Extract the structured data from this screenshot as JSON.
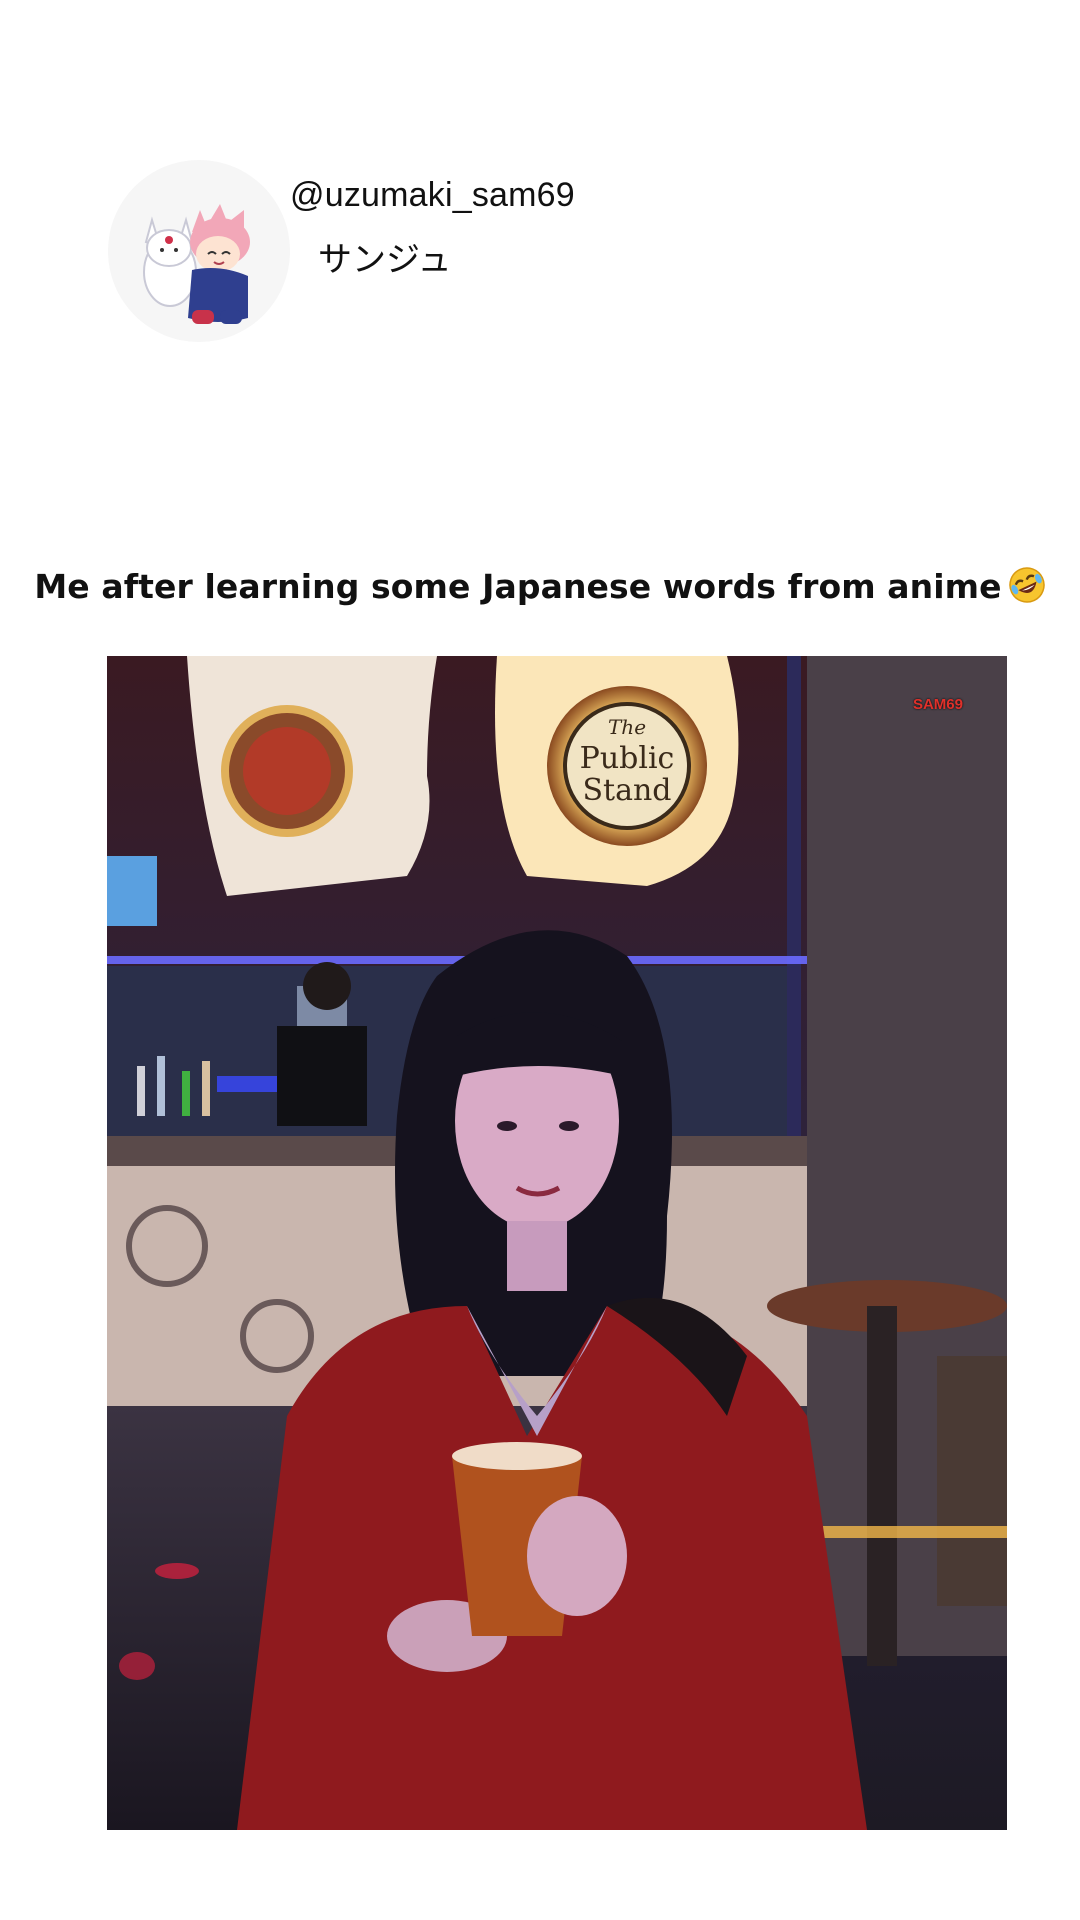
{
  "profile": {
    "username": "@uzumaki_sam69",
    "subname": "サンジュ"
  },
  "post": {
    "caption": "Me after learning some Japanese words from anime",
    "caption_emoji": "rolling-on-floor-laughing-emoji"
  },
  "video": {
    "watermark": "SAM69",
    "sign_text_line1": "The",
    "sign_text_line2": "Public",
    "sign_text_line3": "Stand"
  },
  "colors": {
    "background": "#ffffff",
    "text": "#111111",
    "watermark": "#e0302a"
  }
}
